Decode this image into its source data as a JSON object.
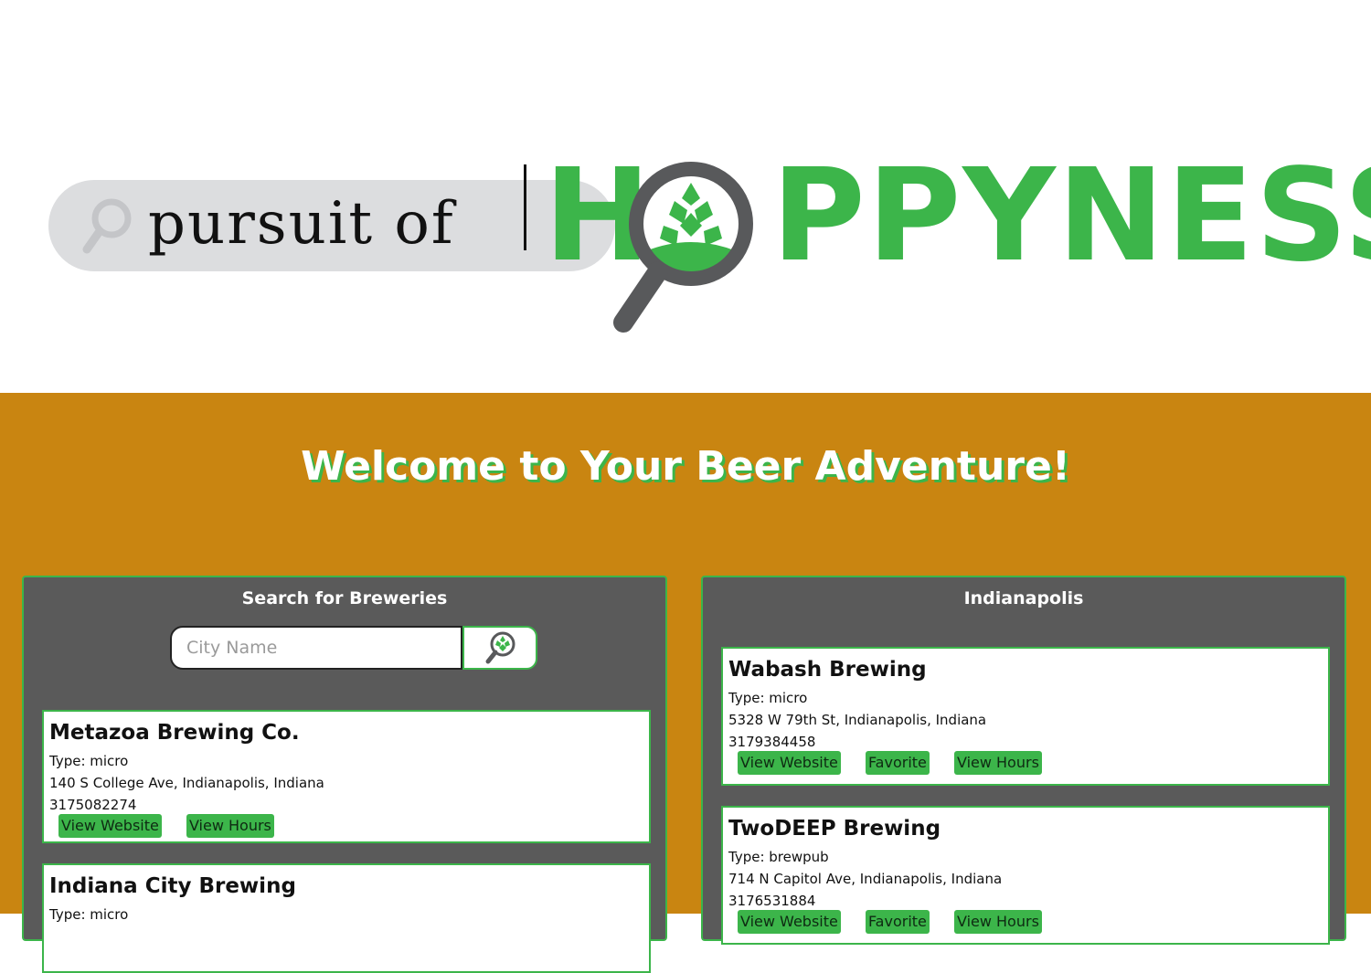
{
  "logo": {
    "part1": "pursuit of",
    "part2_left": "H",
    "part2_right": "PPYNESS"
  },
  "welcome": "Welcome to Your Beer Adventure!",
  "search_panel": {
    "title": "Search for Breweries",
    "placeholder": "City Name",
    "results": [
      {
        "name": "Metazoa Brewing Co.",
        "type": "Type: micro",
        "address": "140 S College Ave, Indianapolis, Indiana",
        "phone": "3175082274",
        "buttons": [
          "View Website",
          "View Hours"
        ]
      },
      {
        "name": "Indiana City Brewing",
        "type": "Type: micro",
        "address": "",
        "phone": "",
        "buttons": []
      }
    ]
  },
  "city_panel": {
    "title": "Indianapolis",
    "results": [
      {
        "name": "Wabash Brewing",
        "type": "Type: micro",
        "address": "5328 W 79th St, Indianapolis, Indiana",
        "phone": "3179384458",
        "buttons": [
          "View Website",
          "Favorite",
          "View Hours"
        ]
      },
      {
        "name": "TwoDEEP Brewing",
        "type": "Type: brewpub",
        "address": "714 N Capitol Ave, Indianapolis, Indiana",
        "phone": "3176531884",
        "buttons": [
          "View Website",
          "Favorite",
          "View Hours"
        ]
      }
    ]
  },
  "colors": {
    "green": "#3cb54a",
    "amber": "#c98511",
    "panel_gray": "#5a5a5a"
  }
}
